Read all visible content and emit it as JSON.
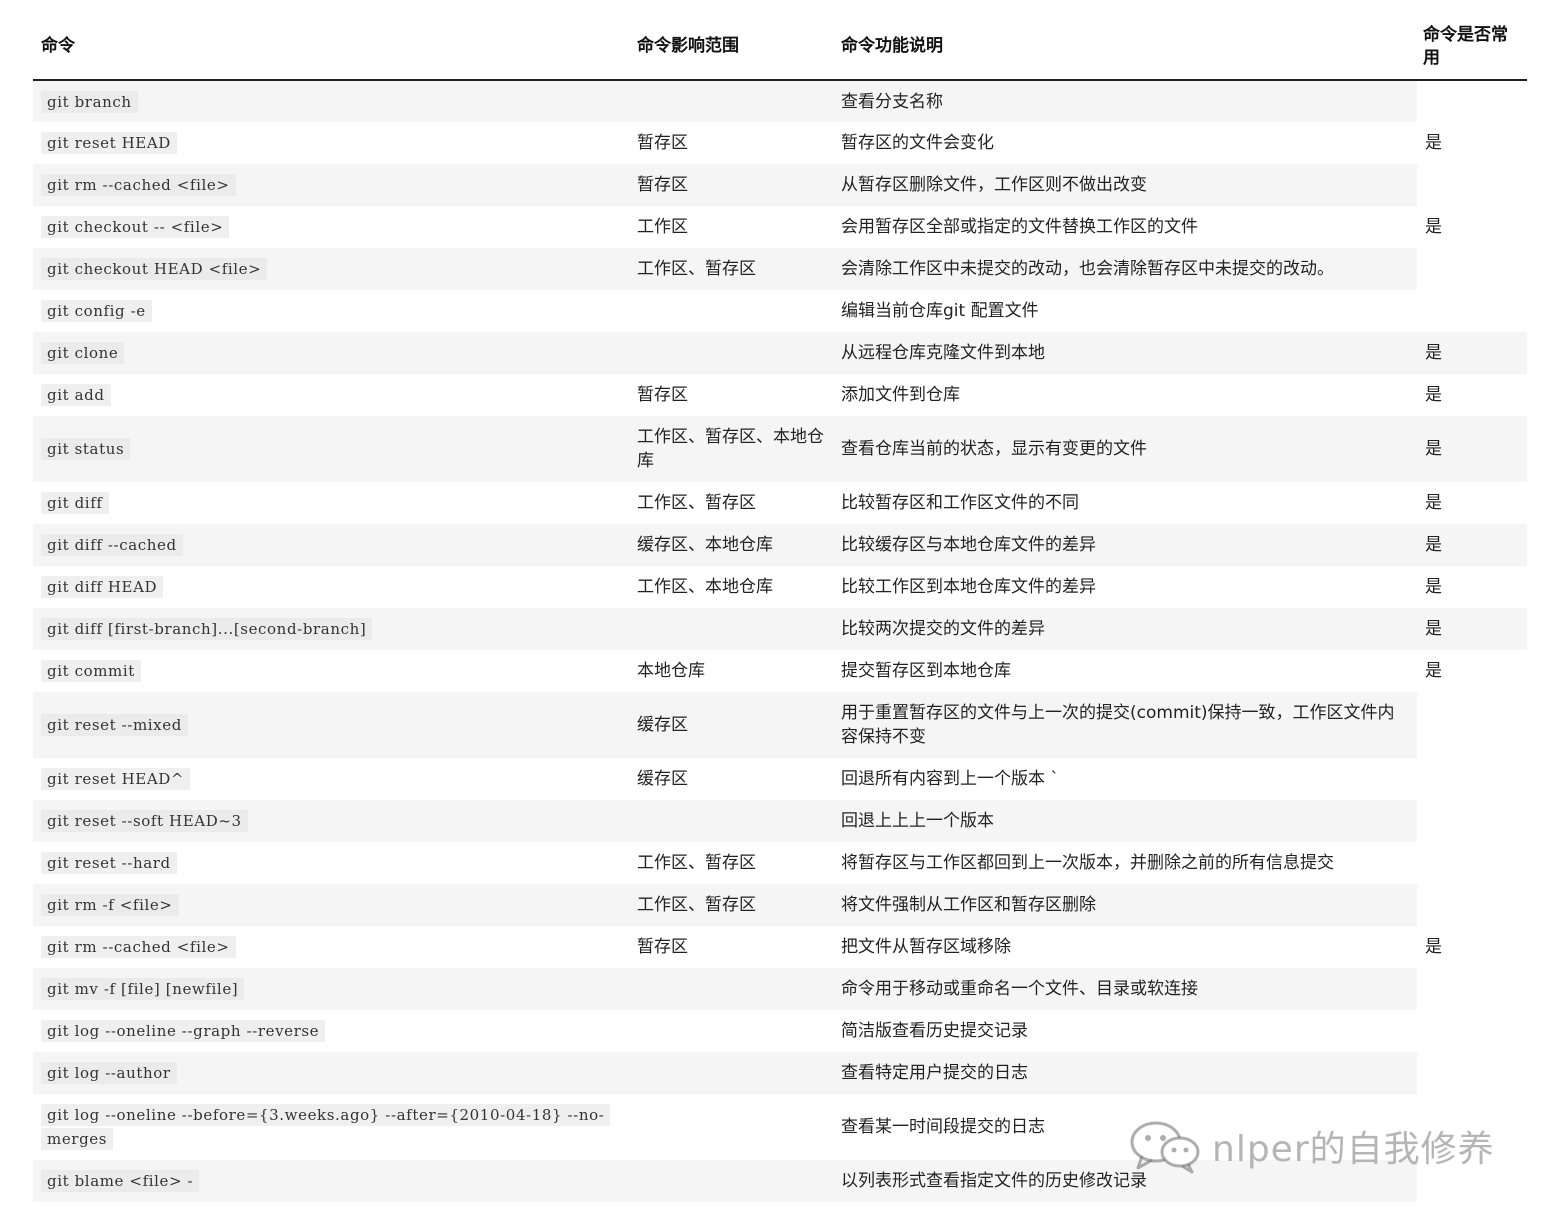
{
  "headers": [
    "命令",
    "命令影响范围",
    "命令功能说明",
    "命令是否常用"
  ],
  "rows": [
    {
      "cmd": "git branch",
      "scope": "",
      "desc": "查看分支名称",
      "common": ""
    },
    {
      "cmd": "git reset HEAD",
      "scope": "暂存区",
      "desc": "暂存区的文件会变化",
      "common": "是"
    },
    {
      "cmd": "git rm --cached <file>",
      "scope": "暂存区",
      "desc": "从暂存区删除文件，工作区则不做出改变",
      "common": ""
    },
    {
      "cmd": "git checkout -- <file>",
      "scope": "工作区",
      "desc": "会用暂存区全部或指定的文件替换工作区的文件",
      "common": "是"
    },
    {
      "cmd": "git checkout HEAD <file>",
      "scope": "工作区、暂存区",
      "desc": "会清除工作区中未提交的改动，也会清除暂存区中未提交的改动。",
      "common": ""
    },
    {
      "cmd": "git config -e",
      "scope": "",
      "desc": "编辑当前仓库git 配置文件",
      "common": ""
    },
    {
      "cmd": "git clone",
      "scope": "",
      "desc": "从远程仓库克隆文件到本地",
      "common": "是"
    },
    {
      "cmd": "git add",
      "scope": "暂存区",
      "desc": "添加文件到仓库",
      "common": "是"
    },
    {
      "cmd": "git status",
      "scope": "工作区、暂存区、本地仓库",
      "desc": "查看仓库当前的状态，显示有变更的文件",
      "common": "是"
    },
    {
      "cmd": "git diff",
      "scope": "工作区、暂存区",
      "desc": "比较暂存区和工作区文件的不同",
      "common": "是"
    },
    {
      "cmd": "git diff --cached",
      "scope": "缓存区、本地仓库",
      "desc": "比较缓存区与本地仓库文件的差异",
      "common": "是"
    },
    {
      "cmd": "git diff HEAD",
      "scope": "工作区、本地仓库",
      "desc": "比较工作区到本地仓库文件的差异",
      "common": "是"
    },
    {
      "cmd": "git diff [first-branch]...[second-branch]",
      "scope": "",
      "desc": "比较两次提交的文件的差异",
      "common": "是"
    },
    {
      "cmd": "git commit",
      "scope": "本地仓库",
      "desc": "提交暂存区到本地仓库",
      "common": "是"
    },
    {
      "cmd": "git reset --mixed",
      "scope": "缓存区",
      "desc": "用于重置暂存区的文件与上一次的提交(commit)保持一致，工作区文件内容保持不变",
      "common": ""
    },
    {
      "cmd": "git reset HEAD^",
      "scope": "缓存区",
      "desc": "回退所有内容到上一个版本 `",
      "common": ""
    },
    {
      "cmd": "git reset --soft HEAD~3",
      "scope": "",
      "desc": "回退上上上一个版本",
      "common": ""
    },
    {
      "cmd": "git reset --hard",
      "scope": "工作区、暂存区",
      "desc": "将暂存区与工作区都回到上一次版本，并删除之前的所有信息提交",
      "common": ""
    },
    {
      "cmd": "git rm -f <file>",
      "scope": "工作区、暂存区",
      "desc": "将文件强制从工作区和暂存区删除",
      "common": ""
    },
    {
      "cmd": "git rm --cached <file>",
      "scope": "暂存区",
      "desc": "把文件从暂存区域移除",
      "common": "是"
    },
    {
      "cmd": "git mv -f [file] [newfile]",
      "scope": "",
      "desc": "命令用于移动或重命名一个文件、目录或软连接",
      "common": ""
    },
    {
      "cmd": "git log --oneline --graph --reverse",
      "scope": "",
      "desc": "简洁版查看历史提交记录",
      "common": ""
    },
    {
      "cmd": "git log --author",
      "scope": "",
      "desc": "查看特定用户提交的日志",
      "common": ""
    },
    {
      "cmd": "git log --oneline --before={3.weeks.ago} --after={2010-04-18} --no-merges",
      "scope": "",
      "desc": "查看某一时间段提交的日志",
      "common": ""
    },
    {
      "cmd": "git blame <file> -",
      "scope": "",
      "desc": "以列表形式查看指定文件的历史修改记录",
      "common": ""
    }
  ],
  "watermark": {
    "text": "nlper的自我修养",
    "icon": "wechat-icon"
  }
}
